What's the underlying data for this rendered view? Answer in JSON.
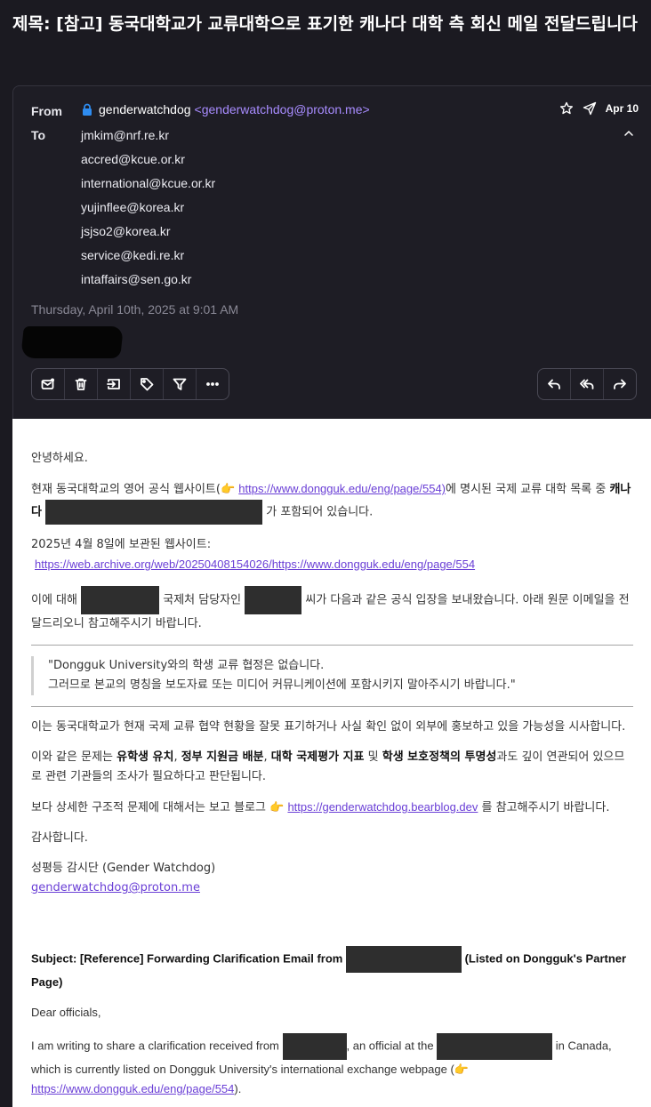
{
  "subject": "제목: [참고] 동국대학교가 교류대학으로 표기한 캐나다 대학 측 회신 메일 전달드립니다",
  "header": {
    "from_label": "From",
    "to_label": "To",
    "sender_name": "genderwatchdog",
    "sender_email": "<genderwatchdog@proton.me>",
    "date_short": "Apr 10",
    "recipients": [
      "jmkim@nrf.re.kr",
      "accred@kcue.or.kr",
      "international@kcue.or.kr",
      "yujinflee@korea.kr",
      "jsjso2@korea.kr",
      "service@kedi.re.kr",
      "intaffairs@sen.go.kr"
    ],
    "datetime": "Thursday, April 10th, 2025 at 9:01 AM"
  },
  "toolbar": {
    "left_icons": [
      "mark-unread-icon",
      "trash-icon",
      "move-icon",
      "label-icon",
      "filter-icon",
      "more-icon"
    ],
    "right_icons": [
      "reply-icon",
      "reply-all-icon",
      "forward-icon"
    ]
  },
  "body": {
    "greeting": "안녕하세요.",
    "p1_a": "현재 동국대학교의 영어 공식 웹사이트(👉 ",
    "p1_link": "https://www.dongguk.edu/eng/page/554)",
    "p1_b": "에 명시된 국제 교류 대학 목록 중 ",
    "p1_bold": "캐나다",
    "p1_c": " 가 포함되어 있습니다.",
    "p2_label": "2025년 4월 8일에 보관된 웹사이트:",
    "p2_link": "https://web.archive.org/web/20250408154026/https://www.dongguk.edu/eng/page/554",
    "p3_a": "이에 대해 ",
    "p3_b": " 국제처 담당자인 ",
    "p3_c": " 씨가 다음과 같은 공식 입장을 보내왔습니다. 아래 원문 이메일을 전달드리오니 참고해주시기 바랍니다.",
    "quote_1": "\"Dongguk University와의 학생 교류 협정은 없습니다.",
    "quote_2": "그러므로 본교의 명칭을 보도자료 또는 미디어 커뮤니케이션에 포함시키지 말아주시기 바랍니다.\"",
    "p4": "이는 동국대학교가 현재 국제 교류 협약 현황을 잘못 표기하거나 사실 확인 없이 외부에 홍보하고 있을 가능성을 시사합니다.",
    "p5_a": "이와 같은 문제는 ",
    "p5_b1": "유학생 유치",
    "p5_sep1": ", ",
    "p5_b2": "정부 지원금 배분",
    "p5_sep2": ", ",
    "p5_b3": "대학 국제평가 지표",
    "p5_and": " 및 ",
    "p5_b4": "학생 보호정책의 투명성",
    "p5_c": "과도 깊이 연관되어 있으므로 관련 기관들의 조사가 필요하다고 판단됩니다.",
    "p6_a": "보다 상세한 구조적 문제에 대해서는 보고 블로그 👉 ",
    "p6_link": "https://genderwatchdog.bearblog.dev",
    "p6_b": " 를 참고해주시기 바랍니다.",
    "thanks": "감사합니다.",
    "sig_name": "성평등 감시단 (Gender Watchdog)",
    "sig_email": "genderwatchdog@proton.me",
    "en_subject_a": "Subject: [Reference] Forwarding Clarification Email from ",
    "en_subject_b": " (Listed on Dongguk's Partner Page)",
    "en_dear": "Dear officials,",
    "en_p1_a": "I am writing to share a clarification received from ",
    "en_p1_b": ", an official at the ",
    "en_p1_c": " in Canada, which is currently listed on Dongguk University's international exchange webpage (👉 ",
    "en_p1_link": "https://www.dongguk.edu/eng/page/554",
    "en_p1_d": ")."
  }
}
